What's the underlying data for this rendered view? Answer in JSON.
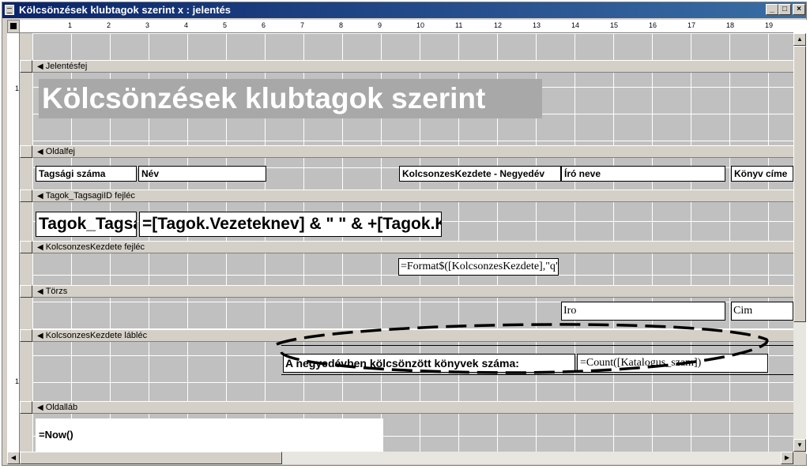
{
  "window": {
    "title": "Kölcsönzések klubtagok szerint x : jelentés",
    "min_glyph": "_",
    "max_glyph": "□",
    "close_glyph": "×"
  },
  "ruler": {
    "labels": [
      "1",
      "2",
      "3",
      "4",
      "5",
      "6",
      "7",
      "8",
      "9",
      "10",
      "11",
      "12",
      "13",
      "14",
      "15",
      "16",
      "17",
      "18",
      "19"
    ]
  },
  "vruler_labels": {
    "head": "1",
    "footer": "1"
  },
  "sections": {
    "report_header": "Jelentésfej",
    "page_header": "Oldalfej",
    "group_header_tag": "Tagok_TagsagiID fejléc",
    "group_header_date": "KolcsonzesKezdete fejléc",
    "detail": "Törzs",
    "group_footer_date": "KolcsonzesKezdete lábléc",
    "page_footer": "Oldalláb"
  },
  "controls": {
    "report_title": "Kölcsönzések klubtagok szerint",
    "col_member_id": "Tagsági száma",
    "col_name": "Név",
    "col_loan_start": "KolcsonzesKezdete - Negyedév",
    "col_author": "Író neve",
    "col_book_title": "Könyv címe",
    "field_member_id": "Tagok_TagsagiID",
    "field_fullname": "=[Tagok.Vezeteknev] & \" \" & +[Tagok.Keresztnev]",
    "field_format_date": "=Format$([KolcsonzesKezdete],\"q\")",
    "field_author": "Iro",
    "field_title": "Cim",
    "footer_label": "A negyedévben kölcsönzött könyvek száma:",
    "footer_count": "=Count([Katalogus_szam])",
    "field_now": "=Now()"
  },
  "icons": {
    "section_arrow": "◀",
    "up": "▲",
    "down": "▼",
    "left": "◀",
    "right": "▶"
  },
  "colors": {
    "title_bar": "#0a246a",
    "section_bar": "#d4d0c8",
    "grid": "#c0c0c0",
    "annotation": "#000000"
  }
}
